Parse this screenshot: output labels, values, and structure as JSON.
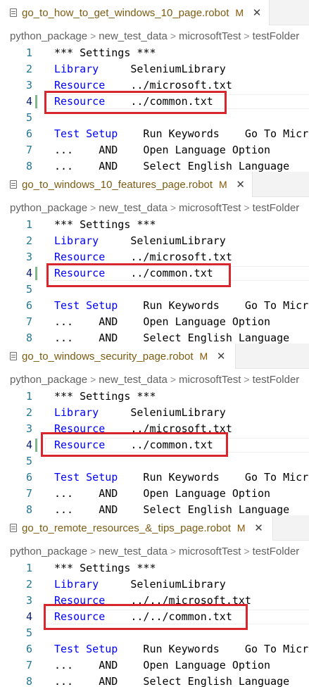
{
  "colors": {
    "keyword": "#0000ff",
    "line_number": "#237893",
    "modified_title": "#7c5b12",
    "git_added": "#81b88b",
    "highlight_box": "#d8262f"
  },
  "icons": {
    "tab_file": "file-icon",
    "tab_close": "close-icon",
    "breadcrumb_separator": "chevron-right-icon"
  },
  "separator_glyph": ">",
  "panels": [
    {
      "tab": {
        "title": "go_to_how_to_get_windows_10_page.robot",
        "modified": "M",
        "close": "✕"
      },
      "breadcrumb": [
        "python_package",
        "new_test_data",
        "microsoftTest",
        "testFolder"
      ],
      "lines": [
        {
          "n": "1",
          "kw": "",
          "rest": "*** Settings ***"
        },
        {
          "n": "2",
          "kw": "Library",
          "rest": "     SeleniumLibrary"
        },
        {
          "n": "3",
          "kw": "Resource",
          "rest": "    ../microsoft.txt"
        },
        {
          "n": "4",
          "kw": "Resource",
          "rest": "    ../common.txt"
        },
        {
          "n": "5",
          "kw": "",
          "rest": ""
        },
        {
          "n": "6",
          "kw": "Test Setup",
          "rest": "    Run Keywords    Go To Microsoft"
        },
        {
          "n": "7",
          "kw": "",
          "rest": "...    AND    Open Language Option"
        },
        {
          "n": "8",
          "kw": "",
          "rest": "...    AND    Select English Language"
        }
      ]
    },
    {
      "tab": {
        "title": "go_to_windows_10_features_page.robot",
        "modified": "M",
        "close": "✕"
      },
      "breadcrumb": [
        "python_package",
        "new_test_data",
        "microsoftTest",
        "testFolder"
      ],
      "lines": [
        {
          "n": "1",
          "kw": "",
          "rest": "*** Settings ***"
        },
        {
          "n": "2",
          "kw": "Library",
          "rest": "     SeleniumLibrary"
        },
        {
          "n": "3",
          "kw": "Resource",
          "rest": "    ../microsoft.txt"
        },
        {
          "n": "4",
          "kw": "Resource",
          "rest": "    ../common.txt"
        },
        {
          "n": "5",
          "kw": "",
          "rest": ""
        },
        {
          "n": "6",
          "kw": "Test Setup",
          "rest": "    Run Keywords    Go To Microsoft"
        },
        {
          "n": "7",
          "kw": "",
          "rest": "...    AND    Open Language Option"
        },
        {
          "n": "8",
          "kw": "",
          "rest": "...    AND    Select English Language"
        }
      ]
    },
    {
      "tab": {
        "title": "go_to_windows_security_page.robot",
        "modified": "M",
        "close": "✕"
      },
      "breadcrumb": [
        "python_package",
        "new_test_data",
        "microsoftTest",
        "testFolder"
      ],
      "lines": [
        {
          "n": "1",
          "kw": "",
          "rest": "*** Settings ***"
        },
        {
          "n": "2",
          "kw": "Library",
          "rest": "     SeleniumLibrary"
        },
        {
          "n": "3",
          "kw": "Resource",
          "rest": "    ../microsoft.txt"
        },
        {
          "n": "4",
          "kw": "Resource",
          "rest": "    ../common.txt"
        },
        {
          "n": "5",
          "kw": "",
          "rest": ""
        },
        {
          "n": "6",
          "kw": "Test Setup",
          "rest": "    Run Keywords    Go To Microsoft"
        },
        {
          "n": "7",
          "kw": "",
          "rest": "...    AND    Open Language Option"
        },
        {
          "n": "8",
          "kw": "",
          "rest": "...    AND    Select English Language"
        }
      ]
    },
    {
      "tab": {
        "title": "go_to_remote_resources_&_tips_page.robot",
        "modified": "M",
        "close": "✕"
      },
      "breadcrumb": [
        "python_package",
        "new_test_data",
        "microsoftTest",
        "testFolder"
      ],
      "lines": [
        {
          "n": "1",
          "kw": "",
          "rest": "*** Settings ***"
        },
        {
          "n": "2",
          "kw": "Library",
          "rest": "     SeleniumLibrary"
        },
        {
          "n": "3",
          "kw": "Resource",
          "rest": "    ../../microsoft.txt"
        },
        {
          "n": "4",
          "kw": "Resource",
          "rest": "    ../../common.txt"
        },
        {
          "n": "5",
          "kw": "",
          "rest": ""
        },
        {
          "n": "6",
          "kw": "Test Setup",
          "rest": "    Run Keywords    Go To Microsoft"
        },
        {
          "n": "7",
          "kw": "",
          "rest": "...    AND    Open Language Option"
        },
        {
          "n": "8",
          "kw": "",
          "rest": "...    AND    Select English Language"
        }
      ]
    }
  ]
}
